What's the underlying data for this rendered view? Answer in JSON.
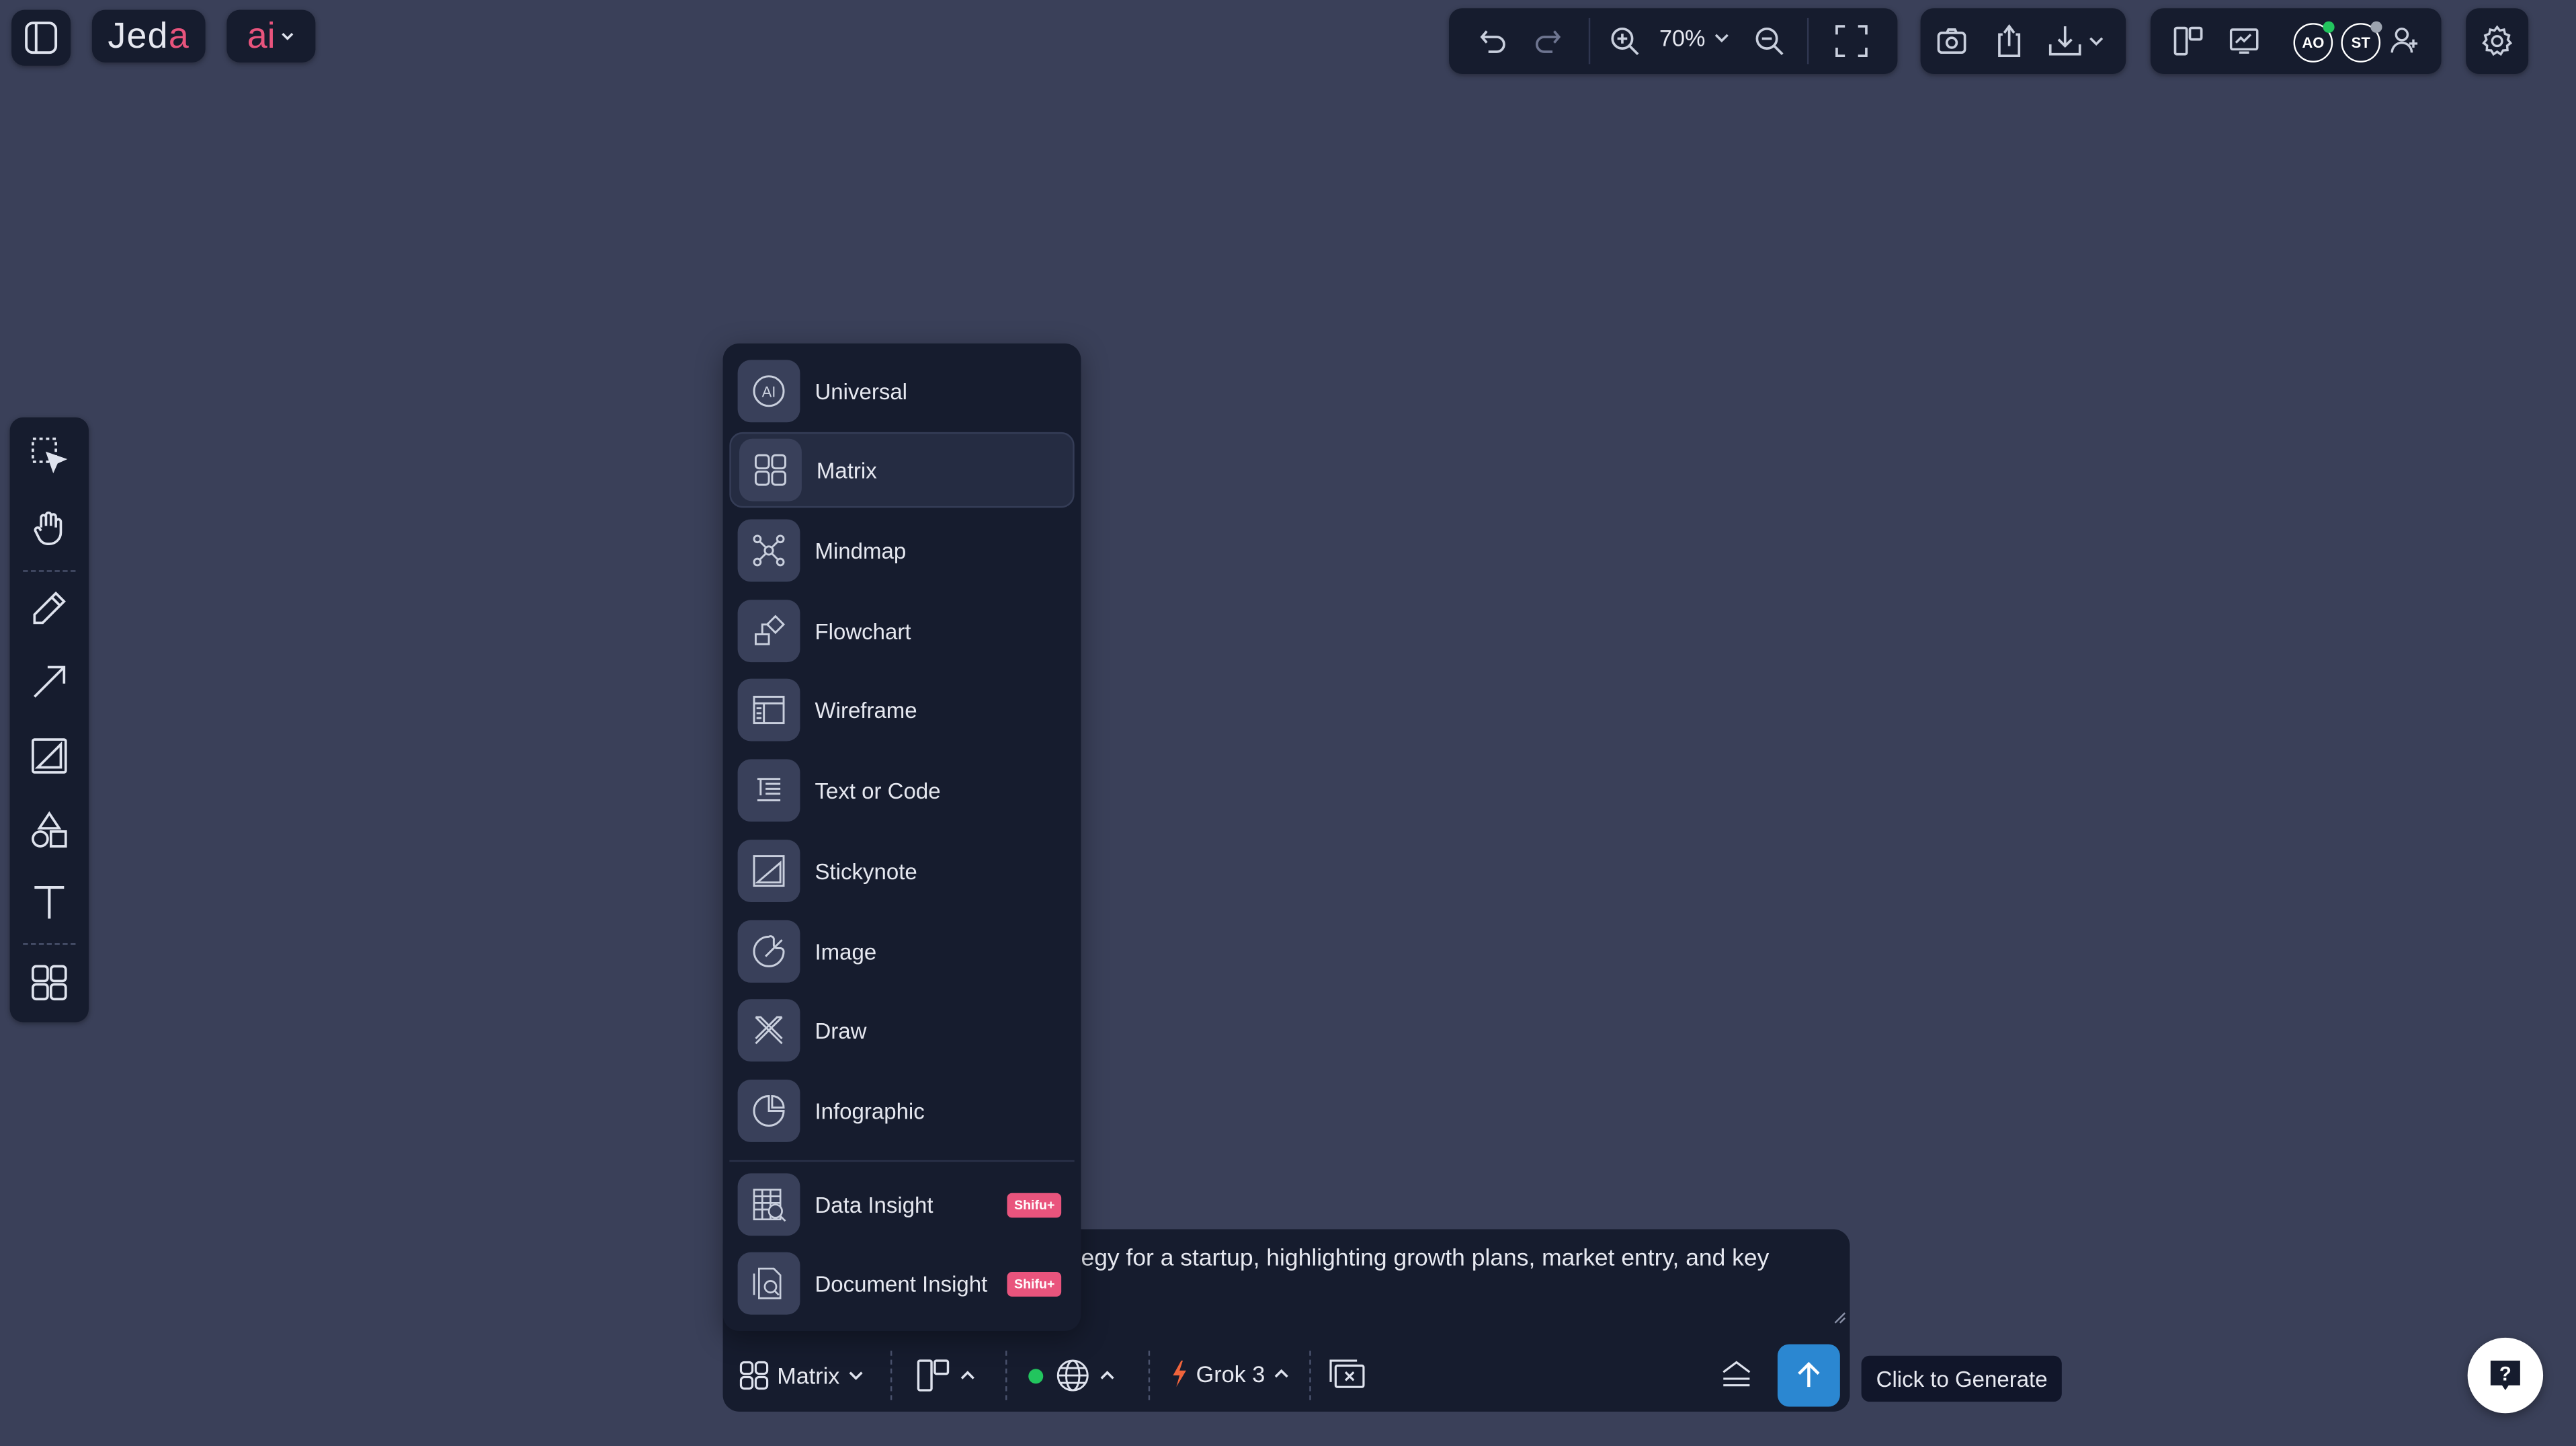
{
  "app": {
    "logo_text": "Jeda",
    "ai_label": "ai"
  },
  "toolbar": {
    "zoom_level": "70%"
  },
  "avatars": [
    {
      "initials": "AO",
      "color": "#e9547d",
      "status": "#22c55e"
    },
    {
      "initials": "ST",
      "color": "#e9547d",
      "status": "#9ca3af"
    }
  ],
  "left_tools": [
    {
      "name": "select-tool",
      "icon": "selection-icon"
    },
    {
      "name": "hand-tool",
      "icon": "hand-icon"
    },
    {
      "name": "pen-tool",
      "icon": "pen-icon"
    },
    {
      "name": "arrow-tool",
      "icon": "arrow-icon"
    },
    {
      "name": "stickynote-tool",
      "icon": "stickynote-icon"
    },
    {
      "name": "shapes-tool",
      "icon": "shapes-icon"
    },
    {
      "name": "text-tool",
      "icon": "text-icon"
    },
    {
      "name": "apps-tool",
      "icon": "grid-icon"
    }
  ],
  "mode_menu": {
    "selected": "Matrix",
    "items": [
      {
        "label": "Universal",
        "icon": "ai-circle-icon"
      },
      {
        "label": "Matrix",
        "icon": "matrix-icon"
      },
      {
        "label": "Mindmap",
        "icon": "mindmap-icon"
      },
      {
        "label": "Flowchart",
        "icon": "flowchart-icon"
      },
      {
        "label": "Wireframe",
        "icon": "wireframe-icon"
      },
      {
        "label": "Text or Code",
        "icon": "text-code-icon"
      },
      {
        "label": "Stickynote",
        "icon": "stickynote-icon"
      },
      {
        "label": "Image",
        "icon": "image-icon"
      },
      {
        "label": "Draw",
        "icon": "draw-icon"
      },
      {
        "label": "Infographic",
        "icon": "infographic-icon"
      },
      {
        "label": "Data Insight",
        "icon": "data-insight-icon",
        "badge": "Shifu+"
      },
      {
        "label": "Document Insight",
        "icon": "document-insight-icon",
        "badge": "Shifu+"
      }
    ]
  },
  "prompt": {
    "text": "egy for a startup, highlighting growth plans, market entry, and key"
  },
  "bottom_bar": {
    "mode_label": "Matrix",
    "model_label": "Grok 3",
    "web_status_color": "#22c55e"
  },
  "generate": {
    "tooltip": "Click to Generate"
  },
  "colors": {
    "canvas": "#3a4059",
    "panel": "#161c2e",
    "accent": "#2b87d1",
    "brand_pink": "#e9547d"
  }
}
